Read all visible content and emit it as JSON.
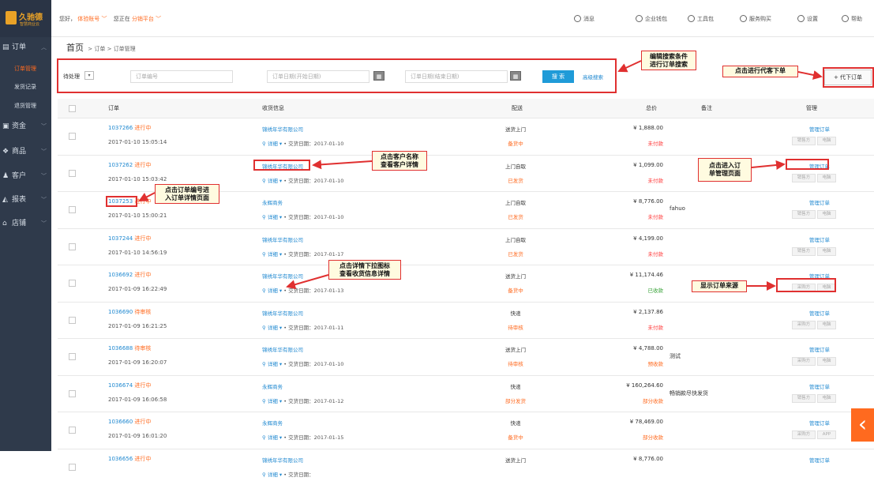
{
  "logo": {
    "text": "久驰德",
    "sub": "智慧商业云"
  },
  "topbar": {
    "greeting": "您好，",
    "account": "体验账号",
    "at_label": "您正在",
    "platform": "分销平台",
    "right": [
      {
        "icon": "message-icon",
        "label": "消息"
      },
      {
        "icon": "wallet-icon",
        "label": "企业钱包"
      },
      {
        "icon": "tool-icon",
        "label": "工具包"
      },
      {
        "icon": "service-icon",
        "label": "服务购买"
      },
      {
        "icon": "settings-icon",
        "label": "设置"
      },
      {
        "icon": "help-icon",
        "label": "帮助"
      }
    ]
  },
  "sidebar": {
    "order": "订单",
    "subs": [
      "订单管理",
      "发货记录",
      "退货管理"
    ],
    "items": [
      "资金",
      "商品",
      "客户",
      "报表",
      "店铺"
    ]
  },
  "breadcrumb": {
    "home": "首页",
    "sep": ">",
    "l1": "订单",
    "l2": "订单管理"
  },
  "search": {
    "status": "待处理",
    "order_no_placeholder": "订单编号",
    "start_placeholder": "订单日期(开始日期)",
    "end_placeholder": "订单日期(结束日期)",
    "search_label": "搜 索",
    "advanced_label": "高级搜索",
    "add_order_label": "+ 代下订单"
  },
  "table": {
    "headers": {
      "order": "订单",
      "customer": "收货信息",
      "ship": "配送",
      "total": "总价",
      "note": "备注",
      "manage": "管理"
    },
    "manage_label": "管理订单",
    "detail_label": "详细",
    "date_label": "交货日期：",
    "rows": [
      {
        "id": "1037266",
        "status": "进行中",
        "time": "2017-01-10 15:05:14",
        "customer": "锦绣年华有限公司",
        "delivery": "2017-01-10",
        "ship": "送货上门",
        "ship_status": "备货中",
        "ship_color": "o",
        "price": "¥ 1,888.00",
        "pay": "未付款",
        "pay_color": "r",
        "note": "",
        "tags": [
          "销售方",
          "电脑"
        ]
      },
      {
        "id": "1037262",
        "status": "进行中",
        "time": "2017-01-10 15:03:42",
        "customer": "锦绣年华有限公司",
        "delivery": "2017-01-10",
        "ship": "上门自取",
        "ship_status": "已发货",
        "ship_color": "o",
        "price": "¥ 1,099.00",
        "pay": "未付款",
        "pay_color": "r",
        "note": "",
        "tags": [
          "销售方",
          "电脑"
        ]
      },
      {
        "id": "1037253",
        "status": "进行中",
        "time": "2017-01-10 15:00:21",
        "customer": "永辉商务",
        "delivery": "2017-01-10",
        "ship": "上门自取",
        "ship_status": "已发货",
        "ship_color": "o",
        "price": "¥ 8,776.00",
        "pay": "未付款",
        "pay_color": "r",
        "note": "fahuo",
        "tags": [
          "销售方",
          "电脑"
        ]
      },
      {
        "id": "1037244",
        "status": "进行中",
        "time": "2017-01-10 14:56:19",
        "customer": "锦绣年华有限公司",
        "delivery": "2017-01-17",
        "ship": "上门自取",
        "ship_status": "已发货",
        "ship_color": "o",
        "price": "¥ 4,199.00",
        "pay": "未付款",
        "pay_color": "r",
        "note": "",
        "tags": [
          "销售方",
          "电脑"
        ]
      },
      {
        "id": "1036692",
        "status": "进行中",
        "time": "2017-01-09 16:22:49",
        "customer": "锦绣年华有限公司",
        "delivery": "2017-01-13",
        "ship": "送货上门",
        "ship_status": "备货中",
        "ship_color": "o",
        "price": "¥ 11,174.46",
        "pay": "已收款",
        "pay_color": "g",
        "note": "",
        "tags": [
          "采购方",
          "电脑"
        ]
      },
      {
        "id": "1036690",
        "status": "待审核",
        "time": "2017-01-09 16:21:25",
        "customer": "锦绣年华有限公司",
        "delivery": "2017-01-11",
        "ship": "快递",
        "ship_status": "待审核",
        "ship_color": "o",
        "price": "¥ 2,137.86",
        "pay": "未付款",
        "pay_color": "r",
        "note": "",
        "tags": [
          "采购方",
          "电脑"
        ]
      },
      {
        "id": "1036688",
        "status": "待审核",
        "time": "2017-01-09 16:20:07",
        "customer": "锦绣年华有限公司",
        "delivery": "2017-01-10",
        "ship": "送货上门",
        "ship_status": "待审核",
        "ship_color": "o",
        "price": "¥ 4,788.00",
        "pay": "预收款",
        "pay_color": "o",
        "note": "测试",
        "tags": [
          "采购方",
          "电脑"
        ]
      },
      {
        "id": "1036674",
        "status": "进行中",
        "time": "2017-01-09 16:06:58",
        "customer": "永辉商务",
        "delivery": "2017-01-12",
        "ship": "快递",
        "ship_status": "部分发货",
        "ship_color": "o",
        "price": "¥ 160,264.60",
        "pay": "部分收款",
        "pay_color": "o",
        "note": "畅销款尽快发货",
        "tags": [
          "销售方",
          "电脑"
        ]
      },
      {
        "id": "1036660",
        "status": "进行中",
        "time": "2017-01-09 16:01:20",
        "customer": "永辉商务",
        "delivery": "2017-01-15",
        "ship": "快递",
        "ship_status": "备货中",
        "ship_color": "o",
        "price": "¥ 78,469.00",
        "pay": "部分收款",
        "pay_color": "o",
        "note": "",
        "tags": [
          "采购方",
          "APP"
        ]
      },
      {
        "id": "1036656",
        "status": "进行中",
        "time": "",
        "customer": "锦绣年华有限公司",
        "delivery": "",
        "ship": "送货上门",
        "ship_status": "",
        "ship_color": "o",
        "price": "¥ 8,776.00",
        "pay": "",
        "pay_color": "r",
        "note": "",
        "tags": []
      }
    ]
  },
  "annotations": {
    "search": "编辑搜索条件\n进行订单搜索",
    "add": "点击进行代客下单",
    "customer": "点击客户名称\n查看客户详情",
    "order_no": "点击订单编号进\n入订单详情页面",
    "detail": "点击详情下拉图标\n查看收货信息详情",
    "manage": "点击进入订\n单管理页面",
    "source": "显示订单来源"
  },
  "colors": {
    "sidebar": "#2f3a4b",
    "accent": "#ff6a1f",
    "link": "#1f88d0",
    "button": "#1f9bd8",
    "annotation_border": "#e03030"
  }
}
